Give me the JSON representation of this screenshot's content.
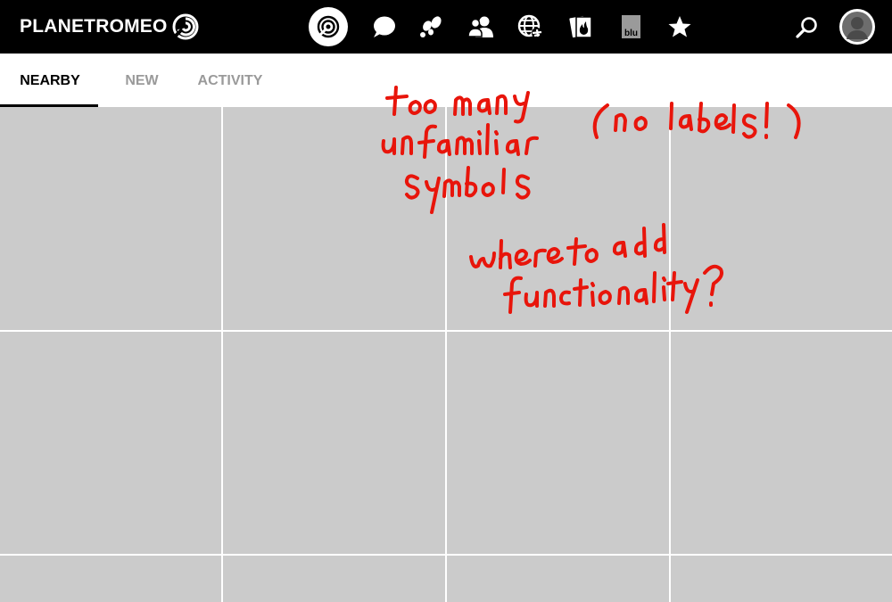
{
  "app": {
    "logo_text": "PLANETROMEO"
  },
  "header": {
    "nav_icons": [
      {
        "name": "radar-icon",
        "active": true
      },
      {
        "name": "chat-bubble-icon",
        "active": false
      },
      {
        "name": "footprints-icon",
        "active": false
      },
      {
        "name": "contacts-icon",
        "active": false
      },
      {
        "name": "globe-plane-icon",
        "active": false
      },
      {
        "name": "flame-cards-icon",
        "active": false
      },
      {
        "name": "blu-icon",
        "active": false,
        "label": "blu"
      },
      {
        "name": "star-icon",
        "active": false
      }
    ],
    "search_icon": "search-icon",
    "avatar_icon": "avatar"
  },
  "tabs": [
    {
      "label": "NEARBY",
      "active": true
    },
    {
      "label": "NEW",
      "active": false
    },
    {
      "label": "ACTIVITY",
      "active": false
    }
  ],
  "grid": {
    "columns": 4,
    "visible_rows": 3,
    "cell_color": "#cbcbcb"
  },
  "annotations": [
    "too many unfamiliar symbols",
    "(no labels!)",
    "where to add functionality?"
  ],
  "colors": {
    "topbar_bg": "#000000",
    "tab_active": "#000000",
    "tab_inactive": "#9a9a9a",
    "annotation": "#e8150b"
  }
}
